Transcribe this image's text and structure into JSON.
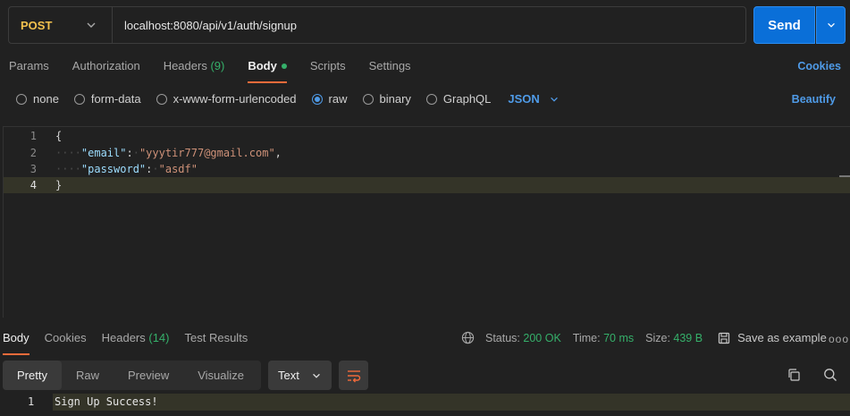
{
  "request": {
    "method": "POST",
    "url": "localhost:8080/api/v1/auth/signup",
    "send_label": "Send"
  },
  "req_tabs": {
    "params": "Params",
    "authorization": "Authorization",
    "headers": "Headers",
    "headers_count": "(9)",
    "body": "Body",
    "scripts": "Scripts",
    "settings": "Settings",
    "cookies": "Cookies"
  },
  "body_types": {
    "none": "none",
    "form_data": "form-data",
    "urlencoded": "x-www-form-urlencoded",
    "raw": "raw",
    "binary": "binary",
    "graphql": "GraphQL",
    "format": "JSON",
    "beautify": "Beautify"
  },
  "editor": {
    "lines": [
      {
        "num": "1",
        "text": "{"
      },
      {
        "num": "2",
        "key": "\"email\"",
        "value": "\"yyytir777@gmail.com\""
      },
      {
        "num": "3",
        "key": "\"password\"",
        "value": "\"asdf\""
      },
      {
        "num": "4",
        "text": "}"
      }
    ]
  },
  "response": {
    "tabs": {
      "body": "Body",
      "cookies": "Cookies",
      "headers": "Headers",
      "headers_count": "(14)",
      "test_results": "Test Results"
    },
    "status_label": "Status:",
    "status_value": "200 OK",
    "time_label": "Time:",
    "time_value": "70 ms",
    "size_label": "Size:",
    "size_value": "439 B",
    "save_example": "Save as example",
    "more": "ooo",
    "views": {
      "pretty": "Pretty",
      "raw": "Raw",
      "preview": "Preview",
      "visualize": "Visualize"
    },
    "format": "Text",
    "line_num": "1",
    "line_text": "Sign Up Success!"
  },
  "colors": {
    "accent_blue": "#0a6fd8",
    "method_yellow": "#f2c14e",
    "status_green": "#35b06a",
    "tab_underline": "#f26b3a"
  }
}
